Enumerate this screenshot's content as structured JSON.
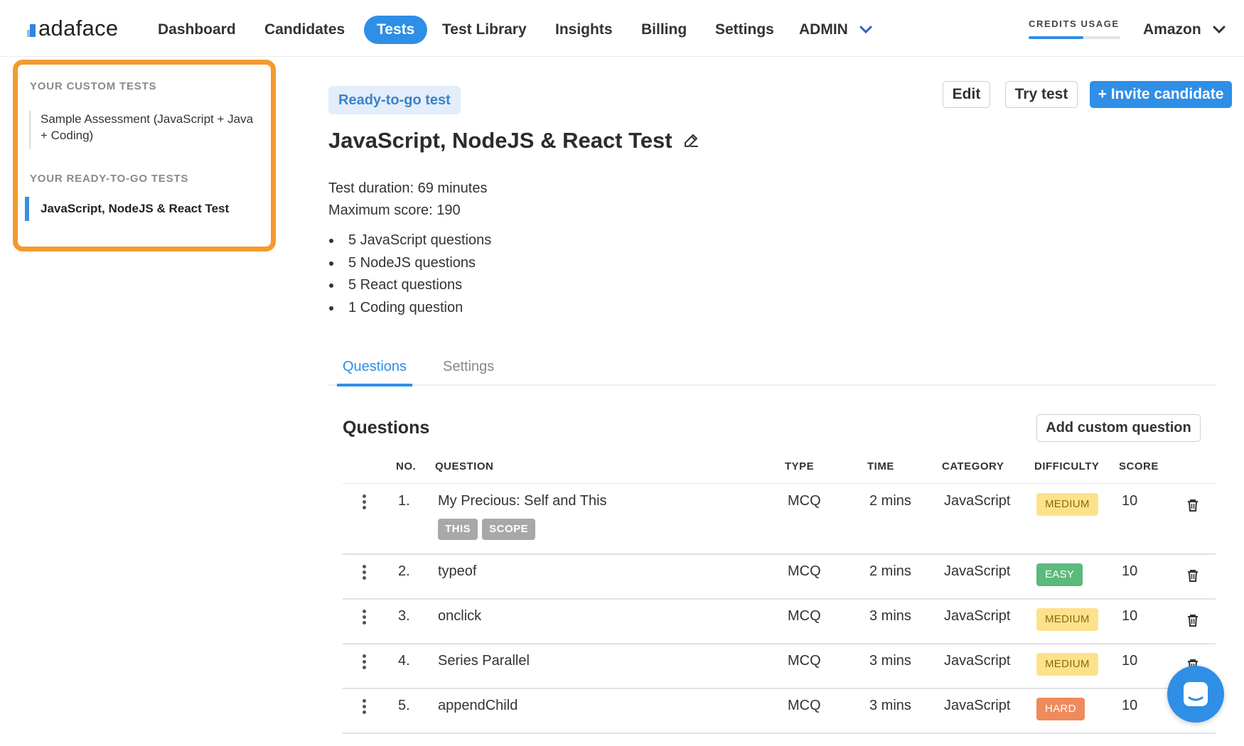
{
  "header": {
    "logo_text": "adaface",
    "nav": [
      {
        "label": "Dashboard",
        "active": false
      },
      {
        "label": "Candidates",
        "active": false
      },
      {
        "label": "Tests",
        "active": true
      },
      {
        "label": "Test Library",
        "active": false
      },
      {
        "label": "Insights",
        "active": false
      },
      {
        "label": "Billing",
        "active": false
      },
      {
        "label": "Settings",
        "active": false
      },
      {
        "label": "ADMIN",
        "active": false
      }
    ],
    "credits_label": "CREDITS USAGE",
    "credits_usage_fraction": 0.6,
    "org_label": "Amazon"
  },
  "sidebar": {
    "custom_heading": "YOUR CUSTOM TESTS",
    "custom_item": "Sample Assessment (JavaScript + Java + Coding)",
    "ready_heading": "YOUR READY-TO-GO TESTS",
    "ready_item": "JavaScript, NodeJS & React Test"
  },
  "main": {
    "badge": "Ready-to-go test",
    "edit_label": "Edit",
    "try_label": "Try test",
    "invite_label": "+ Invite candidate",
    "title": "JavaScript, NodeJS & React Test",
    "duration": "Test duration: 69 minutes",
    "max_score": "Maximum score: 190",
    "bullets": [
      "5 JavaScript questions",
      "5 NodeJS questions",
      "5 React questions",
      "1 Coding question"
    ],
    "tabs": [
      "Questions",
      "Settings"
    ],
    "questions_heading": "Questions",
    "add_custom_label": "Add custom question"
  },
  "table": {
    "columns": [
      "NO.",
      "QUESTION",
      "TYPE",
      "TIME",
      "CATEGORY",
      "DIFFICULTY",
      "SCORE"
    ],
    "rows": [
      {
        "no": "1.",
        "question": "My Precious: Self and This",
        "tags": [
          "THIS",
          "SCOPE"
        ],
        "type": "MCQ",
        "time": "2 mins",
        "category": "JavaScript",
        "difficulty": "MEDIUM",
        "score": "10"
      },
      {
        "no": "2.",
        "question": "typeof",
        "tags": [],
        "type": "MCQ",
        "time": "2 mins",
        "category": "JavaScript",
        "difficulty": "EASY",
        "score": "10"
      },
      {
        "no": "3.",
        "question": "onclick",
        "tags": [],
        "type": "MCQ",
        "time": "3 mins",
        "category": "JavaScript",
        "difficulty": "MEDIUM",
        "score": "10"
      },
      {
        "no": "4.",
        "question": "Series Parallel",
        "tags": [],
        "type": "MCQ",
        "time": "3 mins",
        "category": "JavaScript",
        "difficulty": "MEDIUM",
        "score": "10"
      },
      {
        "no": "5.",
        "question": "appendChild",
        "tags": [],
        "type": "MCQ",
        "time": "3 mins",
        "category": "JavaScript",
        "difficulty": "HARD",
        "score": "10"
      }
    ]
  },
  "colors": {
    "accent": "#2f8ee5",
    "highlight_border": "#f39a2f",
    "medium": "#fde28b",
    "easy": "#5cba7d",
    "hard": "#ef8a5b"
  },
  "icons": [
    "chevron-down-icon",
    "pencil-edit-icon",
    "kebab-menu-icon",
    "trash-icon",
    "chat-icon"
  ]
}
